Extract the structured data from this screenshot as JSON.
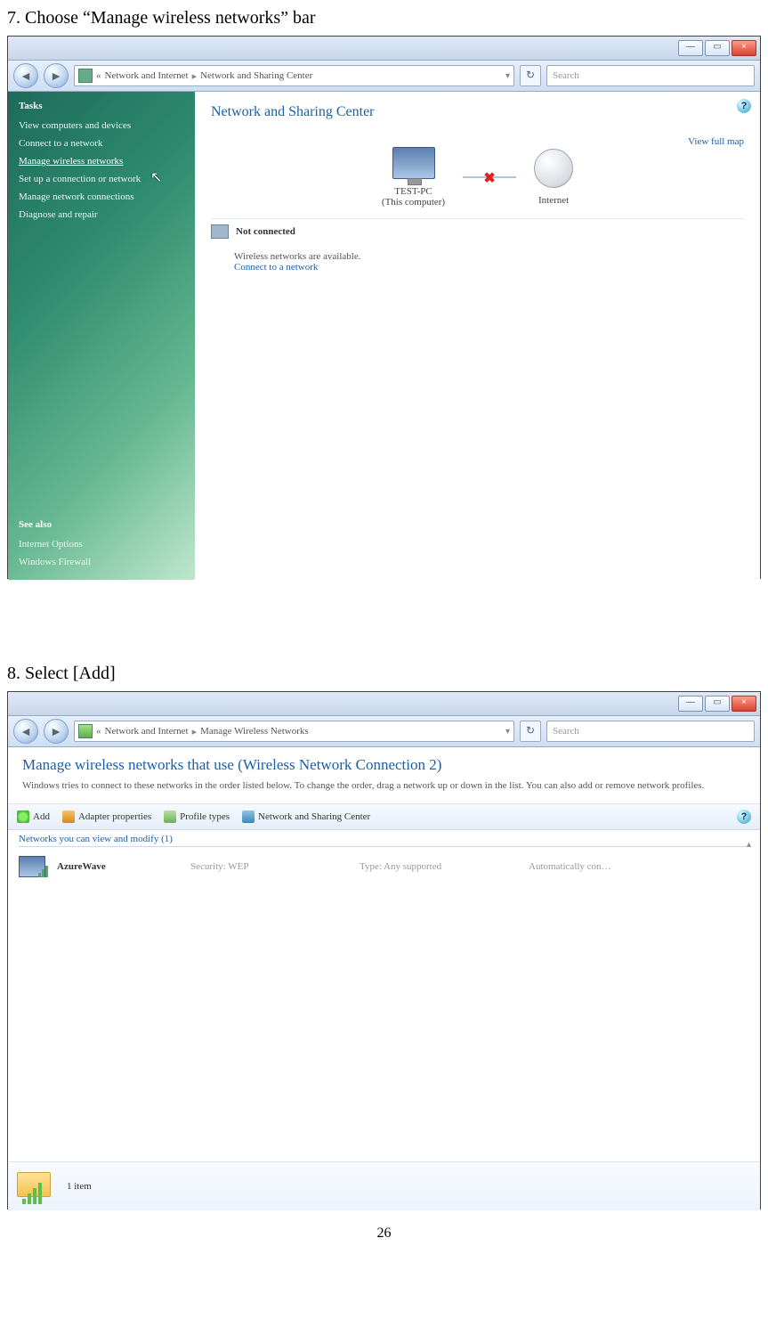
{
  "steps": {
    "s7": "7. Choose “Manage wireless networks” bar",
    "s8": "8. Select [Add]"
  },
  "page_number": "26",
  "win": {
    "min": "—",
    "max": "▭",
    "close": "×"
  },
  "shot1": {
    "breadcrumb": {
      "root": "«",
      "part1": "Network and Internet",
      "part2": "Network and Sharing Center"
    },
    "search_placeholder": "Search",
    "sidebar": {
      "tasks_hdr": "Tasks",
      "items": [
        "View computers and devices",
        "Connect to a network",
        "Manage wireless networks",
        "Set up a connection or network",
        "Manage network connections",
        "Diagnose and repair"
      ],
      "seealso_hdr": "See also",
      "seealso": [
        "Internet Options",
        "Windows Firewall"
      ]
    },
    "content": {
      "title": "Network and Sharing Center",
      "view_full_map": "View full map",
      "pc_name": "TEST-PC",
      "pc_sub": "(This computer)",
      "internet": "Internet",
      "not_connected": "Not connected",
      "wireless_avail": "Wireless networks are available.",
      "connect_link": "Connect to a network"
    }
  },
  "shot2": {
    "breadcrumb": {
      "root": "«",
      "part1": "Network and Internet",
      "part2": "Manage Wireless Networks"
    },
    "search_placeholder": "Search",
    "header": {
      "title": "Manage wireless networks that use (Wireless Network Connection 2)",
      "desc": "Windows tries to connect to these networks in the order listed below. To change the order, drag a network up or down in the list. You can also add or remove network profiles."
    },
    "toolbar": {
      "add": "Add",
      "adapter": "Adapter properties",
      "profile": "Profile types",
      "netshare": "Network and Sharing Center"
    },
    "group_label": "Networks you can view and modify (1)",
    "row": {
      "name": "AzureWave",
      "security": "Security:  WEP",
      "type": "Type:  Any supported",
      "auto": "Automatically con…"
    },
    "status": "1 item"
  }
}
